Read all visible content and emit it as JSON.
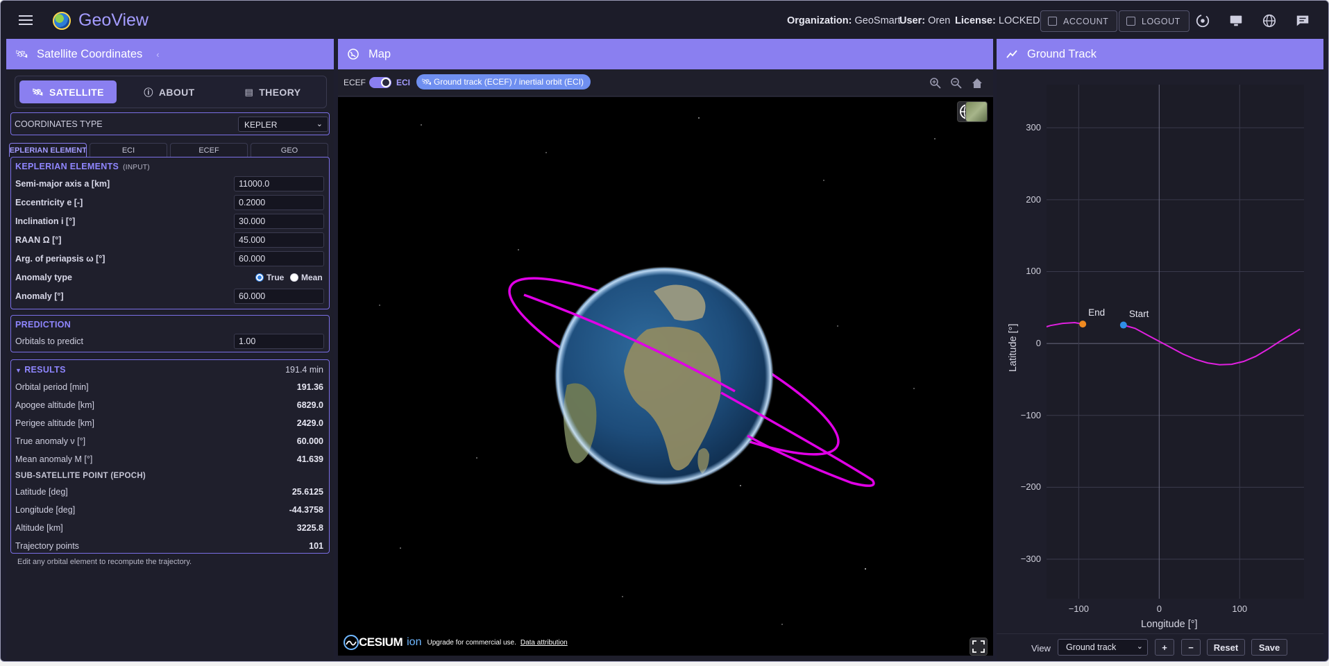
{
  "topbar": {
    "brand": "GeoView",
    "organization_label": "Organization:",
    "organization": "GeoSmart",
    "user_label": "User:",
    "user": "Oren",
    "license_label": "License:",
    "license": "LOCKED",
    "account_label": "ACCOUNT",
    "logout_label": "LOGOUT"
  },
  "left": {
    "title": "Satellite Coordinates",
    "tabs": [
      "SATELLITE",
      "ABOUT",
      "THEORY"
    ],
    "coord_type_label": "COORDINATES TYPE",
    "coord_type_value": "KEPLER",
    "subtabs": [
      "KEPLERIAN ELEMENTS",
      "ECI",
      "ECEF",
      "GEO"
    ],
    "kepler": {
      "title": "KEPLERIAN ELEMENTS",
      "title_note": "(INPUT)",
      "fields": [
        {
          "label": "Semi-major axis a [km]",
          "value": "11000.0"
        },
        {
          "label": "Eccentricity e [-]",
          "value": "0.2000"
        },
        {
          "label": "Inclination i [°]",
          "value": "30.000"
        },
        {
          "label": "RAAN Ω [°]",
          "value": "45.000"
        },
        {
          "label": "Arg. of periapsis ω [°]",
          "value": "60.000"
        }
      ],
      "anomaly_type_label": "Anomaly type",
      "anomaly_true": "True",
      "anomaly_mean": "Mean",
      "anomaly_label": "Anomaly [°]",
      "anomaly_value": "60.000"
    },
    "prediction": {
      "title": "PREDICTION",
      "label": "Orbitals to predict",
      "value": "1.00"
    },
    "results": {
      "title": "RESULTS",
      "summary": "191.4 min",
      "rows": [
        {
          "label": "Orbital period [min]",
          "value": "191.36"
        },
        {
          "label": "Apogee altitude [km]",
          "value": "6829.0"
        },
        {
          "label": "Perigee altitude [km]",
          "value": "2429.0"
        },
        {
          "label": "True anomaly ν [°]",
          "value": "60.000"
        },
        {
          "label": "Mean anomaly M [°]",
          "value": "41.639"
        }
      ],
      "ssp_title": "SUB-SATELLITE POINT (EPOCH)",
      "ssp_rows": [
        {
          "label": "Latitude [deg]",
          "value": "25.6125"
        },
        {
          "label": "Longitude [deg]",
          "value": "-44.3758"
        },
        {
          "label": "Altitude [km]",
          "value": "3225.8"
        },
        {
          "label": "Trajectory points",
          "value": "101"
        }
      ]
    },
    "note": "Edit any orbital element to recompute the trajectory."
  },
  "map": {
    "title": "Map",
    "ecef_label": "ECEF",
    "eci_label": "ECI",
    "chip_label": "Ground track (ECEF) / inertial orbit (ECI)",
    "cesium_logo": "CESIUM",
    "cesium_ion": "ion",
    "upgrade_text": "Upgrade for commercial use.",
    "attribution_link": "Data attribution"
  },
  "groundtrack": {
    "title": "Ground Track",
    "view_label": "View",
    "view_value": "Ground track",
    "btn_plus": "+",
    "btn_minus": "−",
    "btn_reset": "Reset",
    "btn_save": "Save"
  },
  "chart_data": {
    "type": "line",
    "title": "",
    "xlabel": "Longitude [°]",
    "ylabel": "Latitude [°]",
    "xlim": [
      -140,
      180
    ],
    "ylim": [
      -355,
      360
    ],
    "xticks": [
      -100,
      0,
      100
    ],
    "yticks": [
      300,
      200,
      100,
      0,
      -100,
      -200,
      -300
    ],
    "xtick_labels": [
      "−100",
      "0",
      "100"
    ],
    "ytick_labels": [
      "300",
      "200",
      "100",
      "0",
      "−100",
      "−200",
      "−300"
    ],
    "grid": true,
    "series": [
      {
        "color": "#e020e0",
        "x": [
          -44.4,
          -30,
          -15,
          0,
          15,
          30,
          45,
          60,
          75,
          90,
          105,
          120,
          135,
          150,
          165,
          175
        ],
        "y": [
          25.6,
          21,
          12,
          3,
          -6,
          -15,
          -22,
          -27,
          -29.5,
          -29,
          -25,
          -18,
          -8,
          3,
          13,
          20
        ]
      },
      {
        "color": "#e020e0",
        "x": [
          -180,
          -165,
          -150,
          -135,
          -120,
          -105,
          -95
        ],
        "y": [
          8,
          14,
          20,
          25,
          28,
          29,
          27
        ]
      }
    ],
    "markers": [
      {
        "label": "Start",
        "x": -44.4,
        "y": 25.6,
        "color": "#2f8fe8"
      },
      {
        "label": "End",
        "x": -95,
        "y": 27,
        "color": "#f08a20"
      }
    ]
  }
}
